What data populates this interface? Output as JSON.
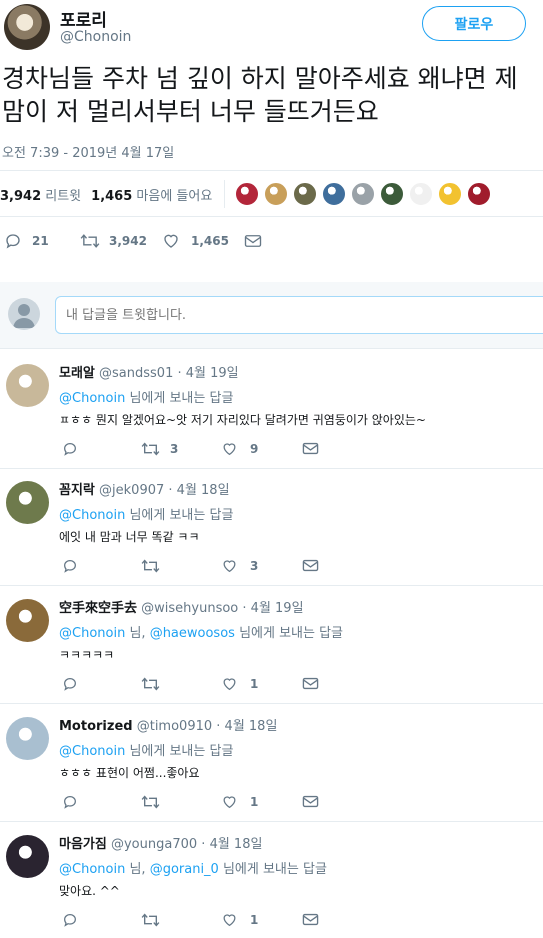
{
  "tweet": {
    "author_name": "포로리",
    "author_handle": "@Chonoin",
    "follow_label": "팔로우",
    "text": "경차님들 주차 넘 깊이 하지 말아주세효 왜냐면 제 맘이 저 멀리서부터 너무 들뜨거든요",
    "timestamp": "오전 7:39 - 2019년 4월 17일",
    "retweets_count": "3,942",
    "retweets_label": "리트윗",
    "likes_count": "1,465",
    "likes_label": "마음에 들어요",
    "likers_colors": [
      "#b3263a",
      "#c89f5a",
      "#6b6a4a",
      "#3f6e9c",
      "#9aa2a8",
      "#3c5b3a",
      "#f0f0f0",
      "#f2c230",
      "#a01c2c"
    ],
    "actions": {
      "reply_count": "21",
      "retweet_count": "3,942",
      "like_count": "1,465"
    }
  },
  "reply_box": {
    "placeholder": "내 답글을 트윗합니다."
  },
  "replies": [
    {
      "name": "모래알",
      "handle": "@sandss01",
      "date": "4월 19일",
      "to_mention": "@Chonoin",
      "to_mention2": "",
      "to_suffix": " 님에게 보내는 답글",
      "text": "ㅍㅎㅎ 뭔지 알겠어요~앗 저기 자리있다 달려가면 귀염둥이가 앉아있는~",
      "retweets": "3",
      "likes": "9",
      "avatar_color": "#c8b89a"
    },
    {
      "name": "꼼지락",
      "handle": "@jek0907",
      "date": "4월 18일",
      "to_mention": "@Chonoin",
      "to_mention2": "",
      "to_suffix": " 님에게 보내는 답글",
      "text": "에잇 내 맘과 너무 똑같 ㅋㅋ",
      "retweets": "",
      "likes": "3",
      "avatar_color": "#6e7a4c"
    },
    {
      "name": "空手來空手去",
      "handle": "@wisehyunsoo",
      "date": "4월 19일",
      "to_mention": "@Chonoin",
      "to_mention2": "@haewoosos",
      "to_suffix": " 님에게 보내는 답글",
      "text": "ㅋㅋㅋㅋㅋ",
      "retweets": "",
      "likes": "1",
      "avatar_color": "#8a6a3a"
    },
    {
      "name": "Motorized",
      "handle": "@timo0910",
      "date": "4월 18일",
      "to_mention": "@Chonoin",
      "to_mention2": "",
      "to_suffix": " 님에게 보내는 답글",
      "text": "ㅎㅎㅎ 표현이 어쩜...좋아요",
      "retweets": "",
      "likes": "1",
      "avatar_color": "#a9bfd0"
    },
    {
      "name": "마음가짐",
      "handle": "@younga700",
      "date": "4월 18일",
      "to_mention": "@Chonoin",
      "to_mention2": "@gorani_0",
      "to_suffix": " 님에게 보내는 답글",
      "text": "맞아요. ^^",
      "retweets": "",
      "likes": "1",
      "avatar_color": "#2a2430"
    }
  ],
  "colors": {
    "accent": "#1da1f2",
    "secondary_text": "#657786",
    "border": "#e6ecf0"
  }
}
